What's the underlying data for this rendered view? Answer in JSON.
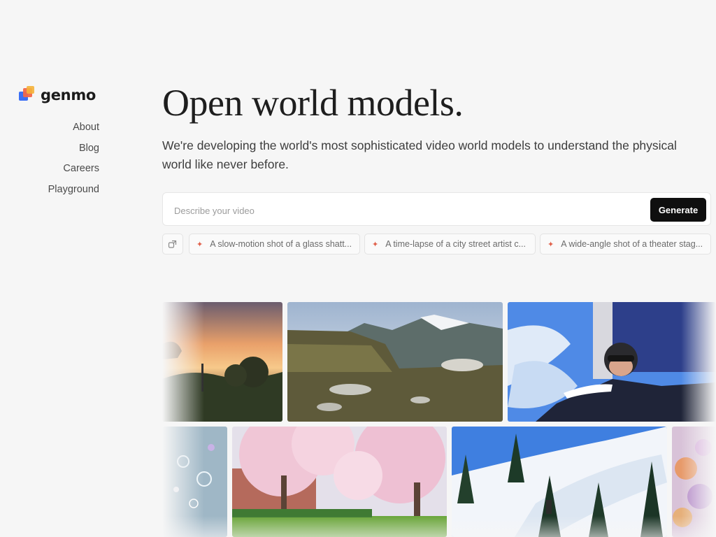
{
  "brand": {
    "name": "genmo"
  },
  "nav": {
    "items": [
      {
        "label": "About"
      },
      {
        "label": "Blog"
      },
      {
        "label": "Careers"
      },
      {
        "label": "Playground"
      }
    ]
  },
  "hero": {
    "title": "Open world models.",
    "subtitle": "We're developing the world's most sophisticated video world models to understand the physical world like never before."
  },
  "prompt": {
    "placeholder": "Describe your video",
    "value": "",
    "generate_label": "Generate"
  },
  "suggestions": [
    {
      "label": "A slow-motion shot of a glass shatt..."
    },
    {
      "label": "A time-lapse of a city street artist c..."
    },
    {
      "label": "A wide-angle shot of a theater stag..."
    }
  ],
  "colors": {
    "background": "#f6f6f6",
    "button": "#0f0f0f",
    "accent": "#e0604a",
    "logo_blue": "#3b6ff5",
    "logo_red": "#f2674a",
    "logo_yellow": "#f5b33a"
  },
  "icons": [
    "shuffle-icon",
    "sparkle-icon"
  ]
}
